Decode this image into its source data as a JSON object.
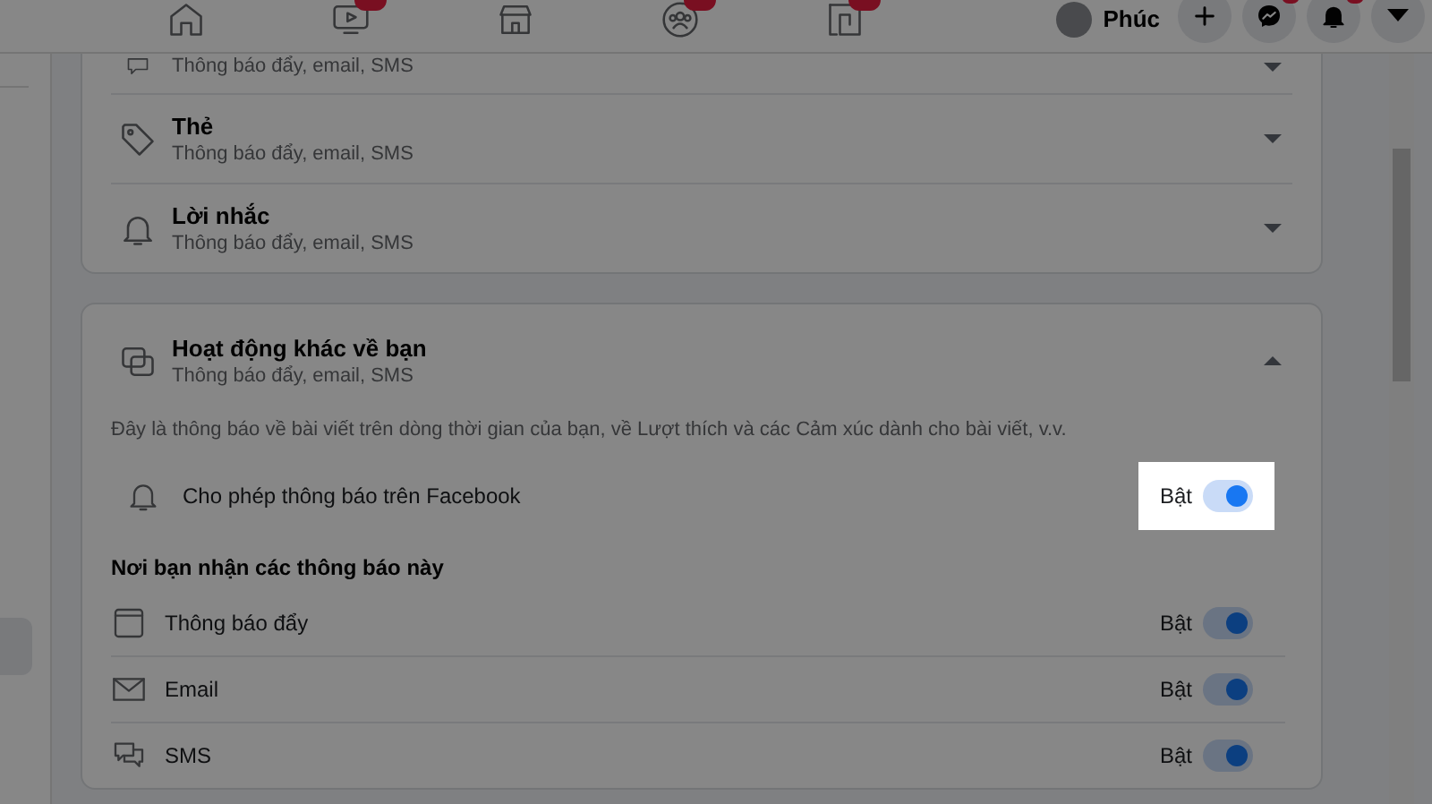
{
  "top_nav": {
    "tabs": [
      {
        "kind": "home",
        "badge": false
      },
      {
        "kind": "video",
        "badge": true
      },
      {
        "kind": "store",
        "badge": false
      },
      {
        "kind": "groups",
        "badge": true
      },
      {
        "kind": "gaming",
        "badge": true
      }
    ],
    "profile": {
      "name": "Phúc"
    },
    "actions": [
      {
        "kind": "plus",
        "badge_dot": false
      },
      {
        "kind": "messenger",
        "badge_dot": true
      },
      {
        "kind": "bell",
        "badge_dot": true
      },
      {
        "kind": "caret",
        "badge_dot": false
      }
    ]
  },
  "cards": [
    {
      "rows": [
        {
          "kind": "comment",
          "subtitle": "Thông báo đẩy, email, SMS",
          "expanded": false
        },
        {
          "kind": "tag",
          "title": "Thẻ",
          "subtitle": "Thông báo đẩy, email, SMS",
          "expanded": false
        },
        {
          "kind": "bell",
          "title": "Lời nhắc",
          "subtitle": "Thông báo đẩy, email, SMS",
          "expanded": false
        }
      ]
    },
    {
      "rows": [
        {
          "kind": "squares",
          "title": "Hoạt động khác về bạn",
          "subtitle": "Thông báo đẩy, email, SMS",
          "expanded": true,
          "description": "Đây là thông báo về bài viết trên dòng thời gian của bạn, về Lượt thích và các Cảm xúc dành cho bài viết, v.v.",
          "allow": {
            "kind": "bell",
            "label": "Cho phép thông báo trên Facebook",
            "state_label": "Bật",
            "on": true,
            "highlighted": true
          },
          "channels_heading": "Nơi bạn nhận các thông báo này",
          "channels": [
            {
              "kind": "window",
              "label": "Thông báo đẩy",
              "state_label": "Bật",
              "on": true,
              "highlighted": false
            },
            {
              "kind": "envelope",
              "label": "Email",
              "state_label": "Bật",
              "on": true,
              "highlighted": false
            },
            {
              "kind": "chat",
              "label": "SMS",
              "state_label": "Bật",
              "on": true,
              "highlighted": false
            }
          ]
        }
      ]
    }
  ]
}
